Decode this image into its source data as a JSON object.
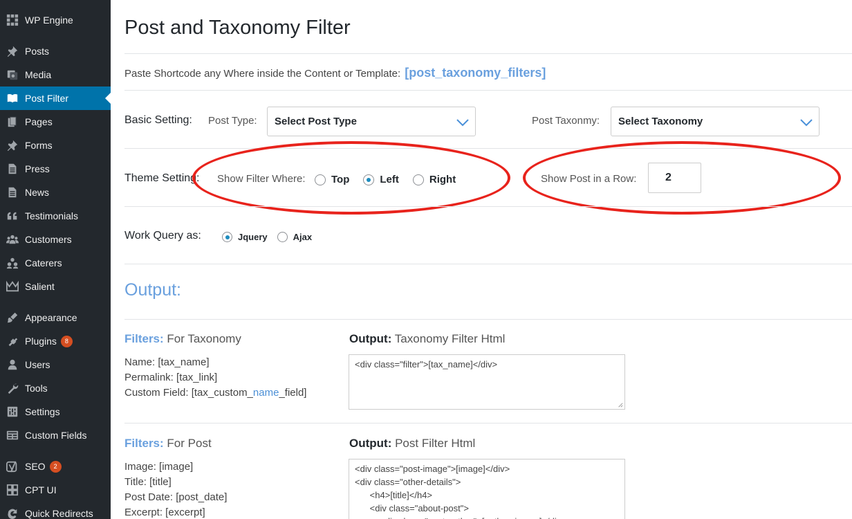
{
  "sidebar": {
    "items": [
      {
        "label": "WP Engine",
        "icon": "wp-engine-icon"
      },
      {
        "label": "Posts",
        "icon": "pin-icon"
      },
      {
        "label": "Media",
        "icon": "media-icon"
      },
      {
        "label": "Post Filter",
        "icon": "book-icon",
        "active": true
      },
      {
        "label": "Pages",
        "icon": "pages-icon"
      },
      {
        "label": "Forms",
        "icon": "pin-icon"
      },
      {
        "label": "Press",
        "icon": "document-icon"
      },
      {
        "label": "News",
        "icon": "document-icon"
      },
      {
        "label": "Testimonials",
        "icon": "quote-icon"
      },
      {
        "label": "Customers",
        "icon": "groups-icon"
      },
      {
        "label": "Caterers",
        "icon": "groups-icon"
      },
      {
        "label": "Salient",
        "icon": "crown-icon"
      },
      {
        "label": "Appearance",
        "icon": "brush-icon"
      },
      {
        "label": "Plugins",
        "icon": "plugin-icon",
        "badge": "8"
      },
      {
        "label": "Users",
        "icon": "user-icon"
      },
      {
        "label": "Tools",
        "icon": "wrench-icon"
      },
      {
        "label": "Settings",
        "icon": "settings-icon"
      },
      {
        "label": "Custom Fields",
        "icon": "fields-icon"
      },
      {
        "label": "SEO",
        "icon": "yoast-icon",
        "badge": "2"
      },
      {
        "label": "CPT UI",
        "icon": "cpt-icon"
      },
      {
        "label": "Quick Redirects",
        "icon": "redirect-icon"
      }
    ]
  },
  "page": {
    "title": "Post and Taxonomy Filter",
    "shortcode_prefix": "Paste Shortcode any Where inside the Content or Template:",
    "shortcode": "[post_taxonomy_filters]"
  },
  "basic": {
    "label": "Basic Setting:",
    "post_type_label": "Post Type:",
    "post_type_value": "Select Post Type",
    "taxonomy_label": "Post Taxonmy:",
    "taxonomy_value": "Select Taxonomy"
  },
  "theme": {
    "label": "Theme Setting:",
    "show_filter_label": "Show Filter Where:",
    "options": [
      "Top",
      "Left",
      "Right"
    ],
    "selected": "Left",
    "row_label": "Show Post in a Row:",
    "row_value": "2"
  },
  "query": {
    "label": "Work Query as:",
    "options": [
      "Jquery",
      "Ajax"
    ],
    "selected": "Jquery"
  },
  "output": {
    "title": "Output:",
    "taxonomy": {
      "filters_word": "Filters:",
      "filters_heading": "For Taxonomy",
      "output_word": "Output:",
      "output_heading": "Taxonomy Filter Html",
      "fields": [
        "Name: [tax_name]",
        "Permalink: [tax_link]"
      ],
      "custom_field_prefix": "Custom Field: [tax_custom_",
      "custom_field_highlight": "name",
      "custom_field_suffix": "_field]",
      "code": "<div class=\"filter\">[tax_name]</div>"
    },
    "post": {
      "filters_word": "Filters:",
      "filters_heading": "For Post",
      "output_word": "Output:",
      "output_heading": "Post Filter Html",
      "fields": [
        "Image: [image]",
        "Title: [title]",
        "Post Date: [post_date]",
        "Excerpt: [excerpt]"
      ],
      "code": "<div class=\"post-image\">[image]</div>\n<div class=\"other-details\">\n      <h4>[title]</h4>\n      <div class=\"about-post\">\n          <div class=\"post-author\">[author_image]</div>"
    }
  },
  "colors": {
    "sidebar_bg": "#23282d",
    "active_bg": "#0073aa",
    "accent_blue": "#6aa0de",
    "annotation_red": "#e8231c",
    "badge": "#d54e21"
  }
}
